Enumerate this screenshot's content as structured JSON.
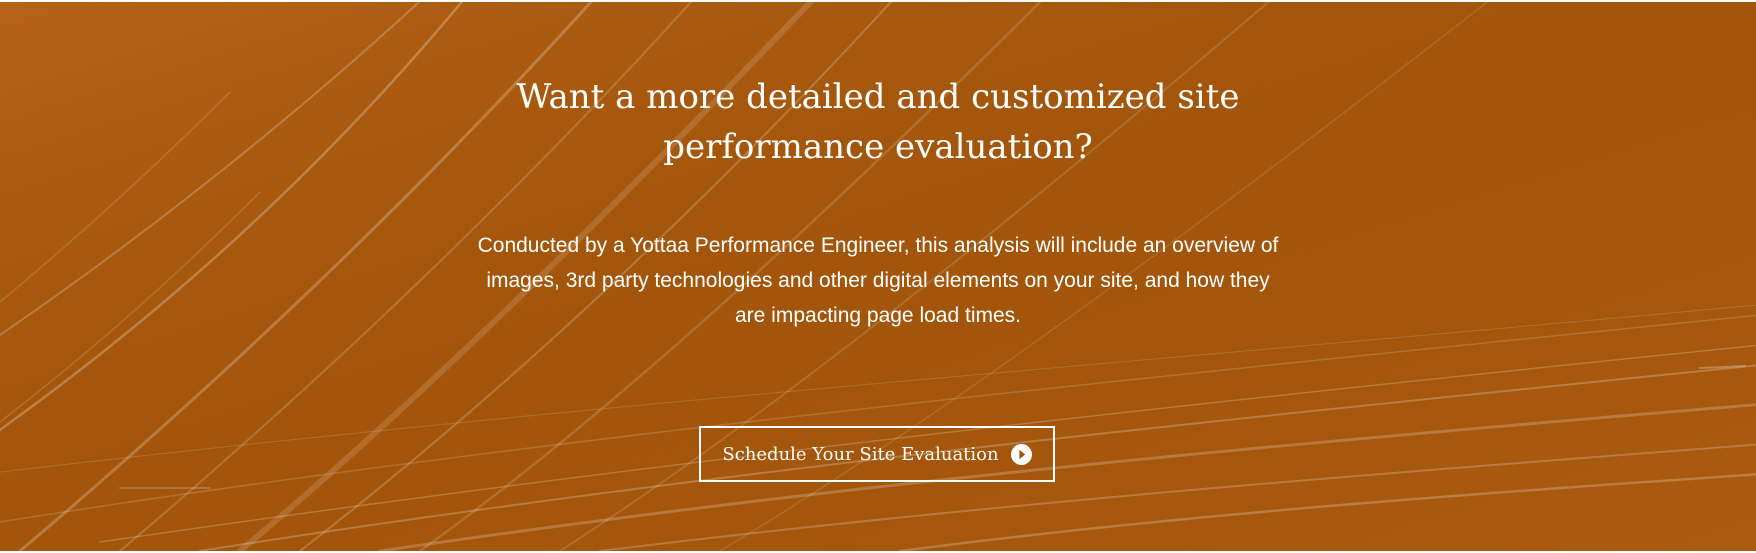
{
  "hero": {
    "headline_line1": "Want a more detailed and customized site",
    "headline_line2": "performance evaluation?",
    "description_line1": "Conducted by a Yottaa Performance Engineer, this analysis will include an overview of",
    "description_line2": "images, 3rd party technologies and other digital elements on your site, and how they",
    "description_line3": "are impacting page load times.",
    "background_color": "#a3560b",
    "background_icon": "light-streaks-background"
  },
  "cta": {
    "label": "Schedule Your Site Evaluation",
    "icon": "play-circle-icon"
  }
}
